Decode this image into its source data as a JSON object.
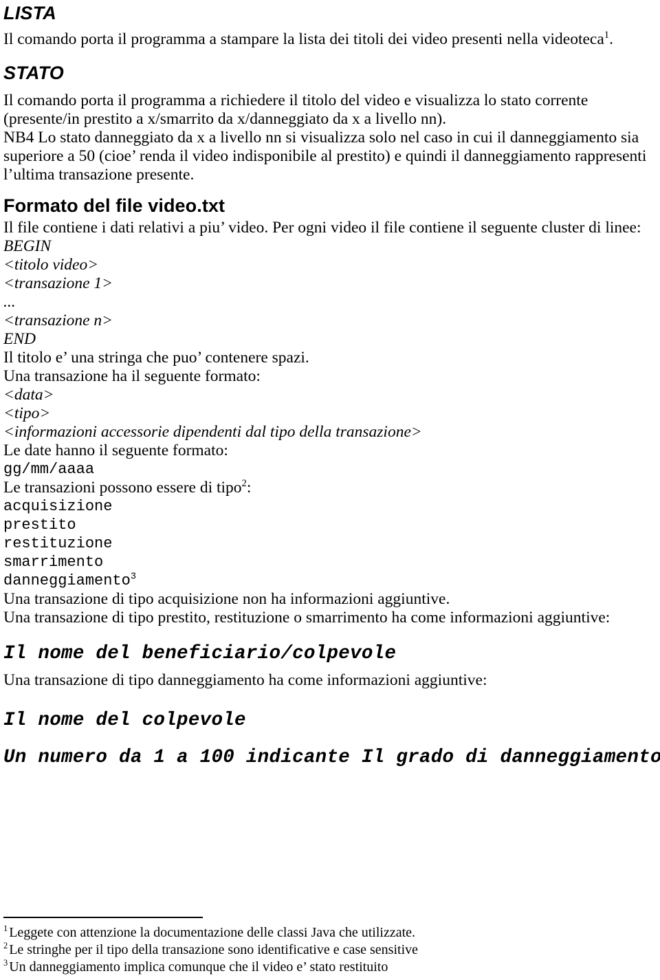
{
  "document": {
    "language": "it",
    "text_color": "#000000",
    "background_color": "#ffffff"
  },
  "sections": [
    {
      "id": "lista",
      "heading": "LISTA",
      "body": "Il comando porta il programma a stampare la lista dei titoli dei video presenti nella videoteca",
      "body_footnote_mark": "1",
      "body_tail": "."
    },
    {
      "id": "stato",
      "heading": "STATO",
      "line1": "Il comando porta il programma a richiedere il titolo del video e visualizza lo stato corrente",
      "line2": "(presente/in prestito a x/smarrito da x/danneggiato da x a livello nn).",
      "nb_line1": "NB4 Lo stato danneggiato da x a livello nn si visualizza solo nel caso in cui il danneggiamento sia",
      "nb_line2": "superiore a 50 (cioe’ renda il video indisponibile al prestito) e quindi il danneggiamento rappresenti",
      "nb_line3": "l’ultima transazione presente."
    }
  ],
  "formato": {
    "heading": "Formato del file video.txt",
    "intro": "Il file contiene i dati relativi a piu’ video. Per ogni video il file contiene il seguente cluster di linee:",
    "cluster": [
      "BEGIN",
      "<titolo video>",
      "<transazione 1>",
      "...",
      "<transazione n>",
      "END"
    ],
    "titolo_note": "Il titolo e’ una stringa che puo’ contenere spazi.",
    "transazione_intro": "Una transazione ha il seguente formato:",
    "transazione_format": [
      "<data>",
      "<tipo>",
      "<informazioni accessorie dipendenti dal tipo della transazione>"
    ],
    "date_intro": "Le date hanno il seguente formato:",
    "date_format": "gg/mm/aaaa",
    "tipi_intro_pre": "Le transazioni possono essere di tipo",
    "tipi_intro_footnote_mark": "2",
    "tipi_intro_post": ":",
    "tipi": [
      {
        "name": "acquisizione",
        "footnote_mark": ""
      },
      {
        "name": "prestito",
        "footnote_mark": ""
      },
      {
        "name": "restituzione",
        "footnote_mark": ""
      },
      {
        "name": "smarrimento",
        "footnote_mark": ""
      },
      {
        "name": "danneggiamento",
        "footnote_mark": "3"
      }
    ],
    "acquisizione_note": "Una transazione di tipo acquisizione non ha informazioni aggiuntive.",
    "prestito_note": "Una transazione di tipo prestito, restituzione o smarrimento ha come informazioni aggiuntive:",
    "prestito_extra": "Il nome del beneficiario/colpevole",
    "danneggiamento_note": "Una transazione di tipo danneggiamento ha come informazioni aggiuntive:",
    "danneggiamento_extra_1": "Il nome del colpevole",
    "danneggiamento_extra_2": "Un numero da 1 a 100 indicante Il grado di danneggiamento"
  },
  "footnotes": [
    {
      "mark": "1",
      "text": "Leggete con attenzione la documentazione delle classi Java che utilizzate."
    },
    {
      "mark": "2",
      "text": "Le stringhe per il tipo della transazione sono identificative e case sensitive"
    },
    {
      "mark": "3",
      "text": "Un danneggiamento implica comunque che il video e’ stato restituito"
    }
  ]
}
